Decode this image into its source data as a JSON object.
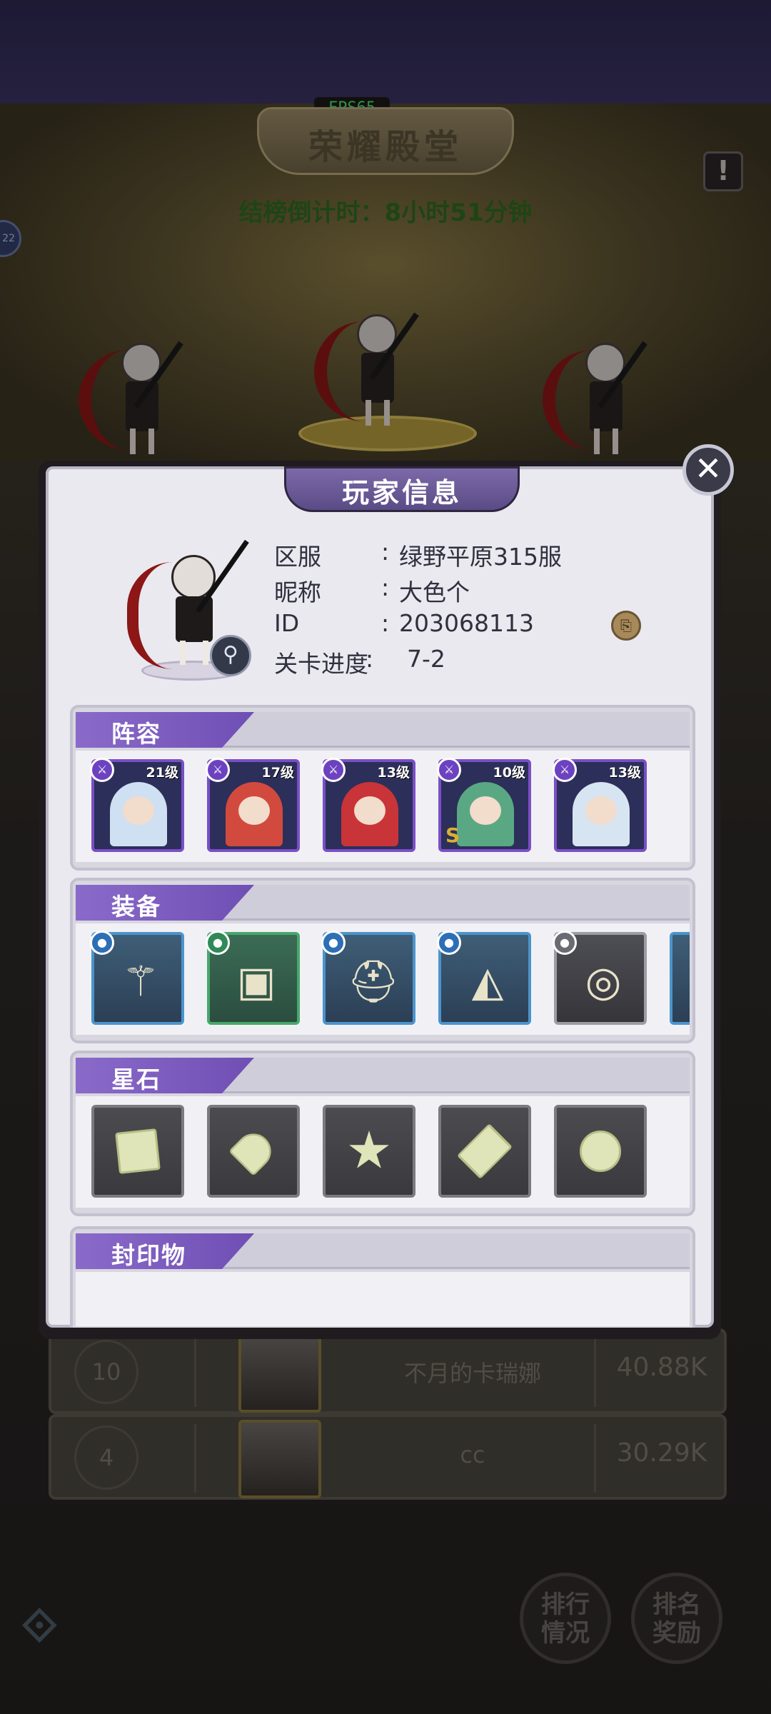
{
  "status": {
    "fps": "FPS65"
  },
  "background": {
    "hall_title": "荣耀殿堂",
    "countdown": "结榜倒计时：8小时51分钟",
    "side_badge": "22",
    "leaderboard": [
      {
        "rank": "10",
        "name": "不月的卡瑞娜",
        "power": "40.88K"
      },
      {
        "rank": "4",
        "name": "cc",
        "power": "30.29K"
      }
    ],
    "buttons": {
      "ranking": "排行\n情况",
      "reward": "排名\n奖励"
    }
  },
  "modal": {
    "title": "玩家信息",
    "close_icon": "close-icon",
    "info": {
      "server_label": "区服",
      "server_value": "绿野平原315服",
      "nickname_label": "昵称",
      "nickname_value": "大色个",
      "id_label": "ID",
      "id_value": "203068113",
      "progress_label": "关卡进度",
      "progress_value": "7-2"
    },
    "sections": {
      "lineup": "阵容",
      "equipment": "装备",
      "starstone": "星石",
      "seal": "封印物"
    },
    "lineup": [
      {
        "level": "21级",
        "hair": "#cfe0f3",
        "rank": ""
      },
      {
        "level": "17级",
        "hair": "#d24a3e",
        "rank": ""
      },
      {
        "level": "13级",
        "hair": "#c93438",
        "rank": ""
      },
      {
        "level": "10级",
        "hair": "#5aa883",
        "rank": "S"
      },
      {
        "level": "13级",
        "hair": "#d7e4f2",
        "rank": ""
      }
    ],
    "equipment": [
      {
        "name": "staff-icon",
        "tier": "blue"
      },
      {
        "name": "card-icon",
        "tier": "green"
      },
      {
        "name": "helmet-icon",
        "tier": "blue"
      },
      {
        "name": "cloak-icon",
        "tier": "blue"
      },
      {
        "name": "ring-icon",
        "tier": "gray"
      }
    ],
    "starstones": [
      {
        "name": "square-stone-icon"
      },
      {
        "name": "heart-stone-icon"
      },
      {
        "name": "star-stone-icon"
      },
      {
        "name": "diamond-stone-icon"
      },
      {
        "name": "round-stone-icon"
      }
    ]
  },
  "colors": {
    "accent_purple": "#7a4fc6",
    "fps_green": "#48e06a",
    "countdown_green": "#2f6b1f"
  }
}
